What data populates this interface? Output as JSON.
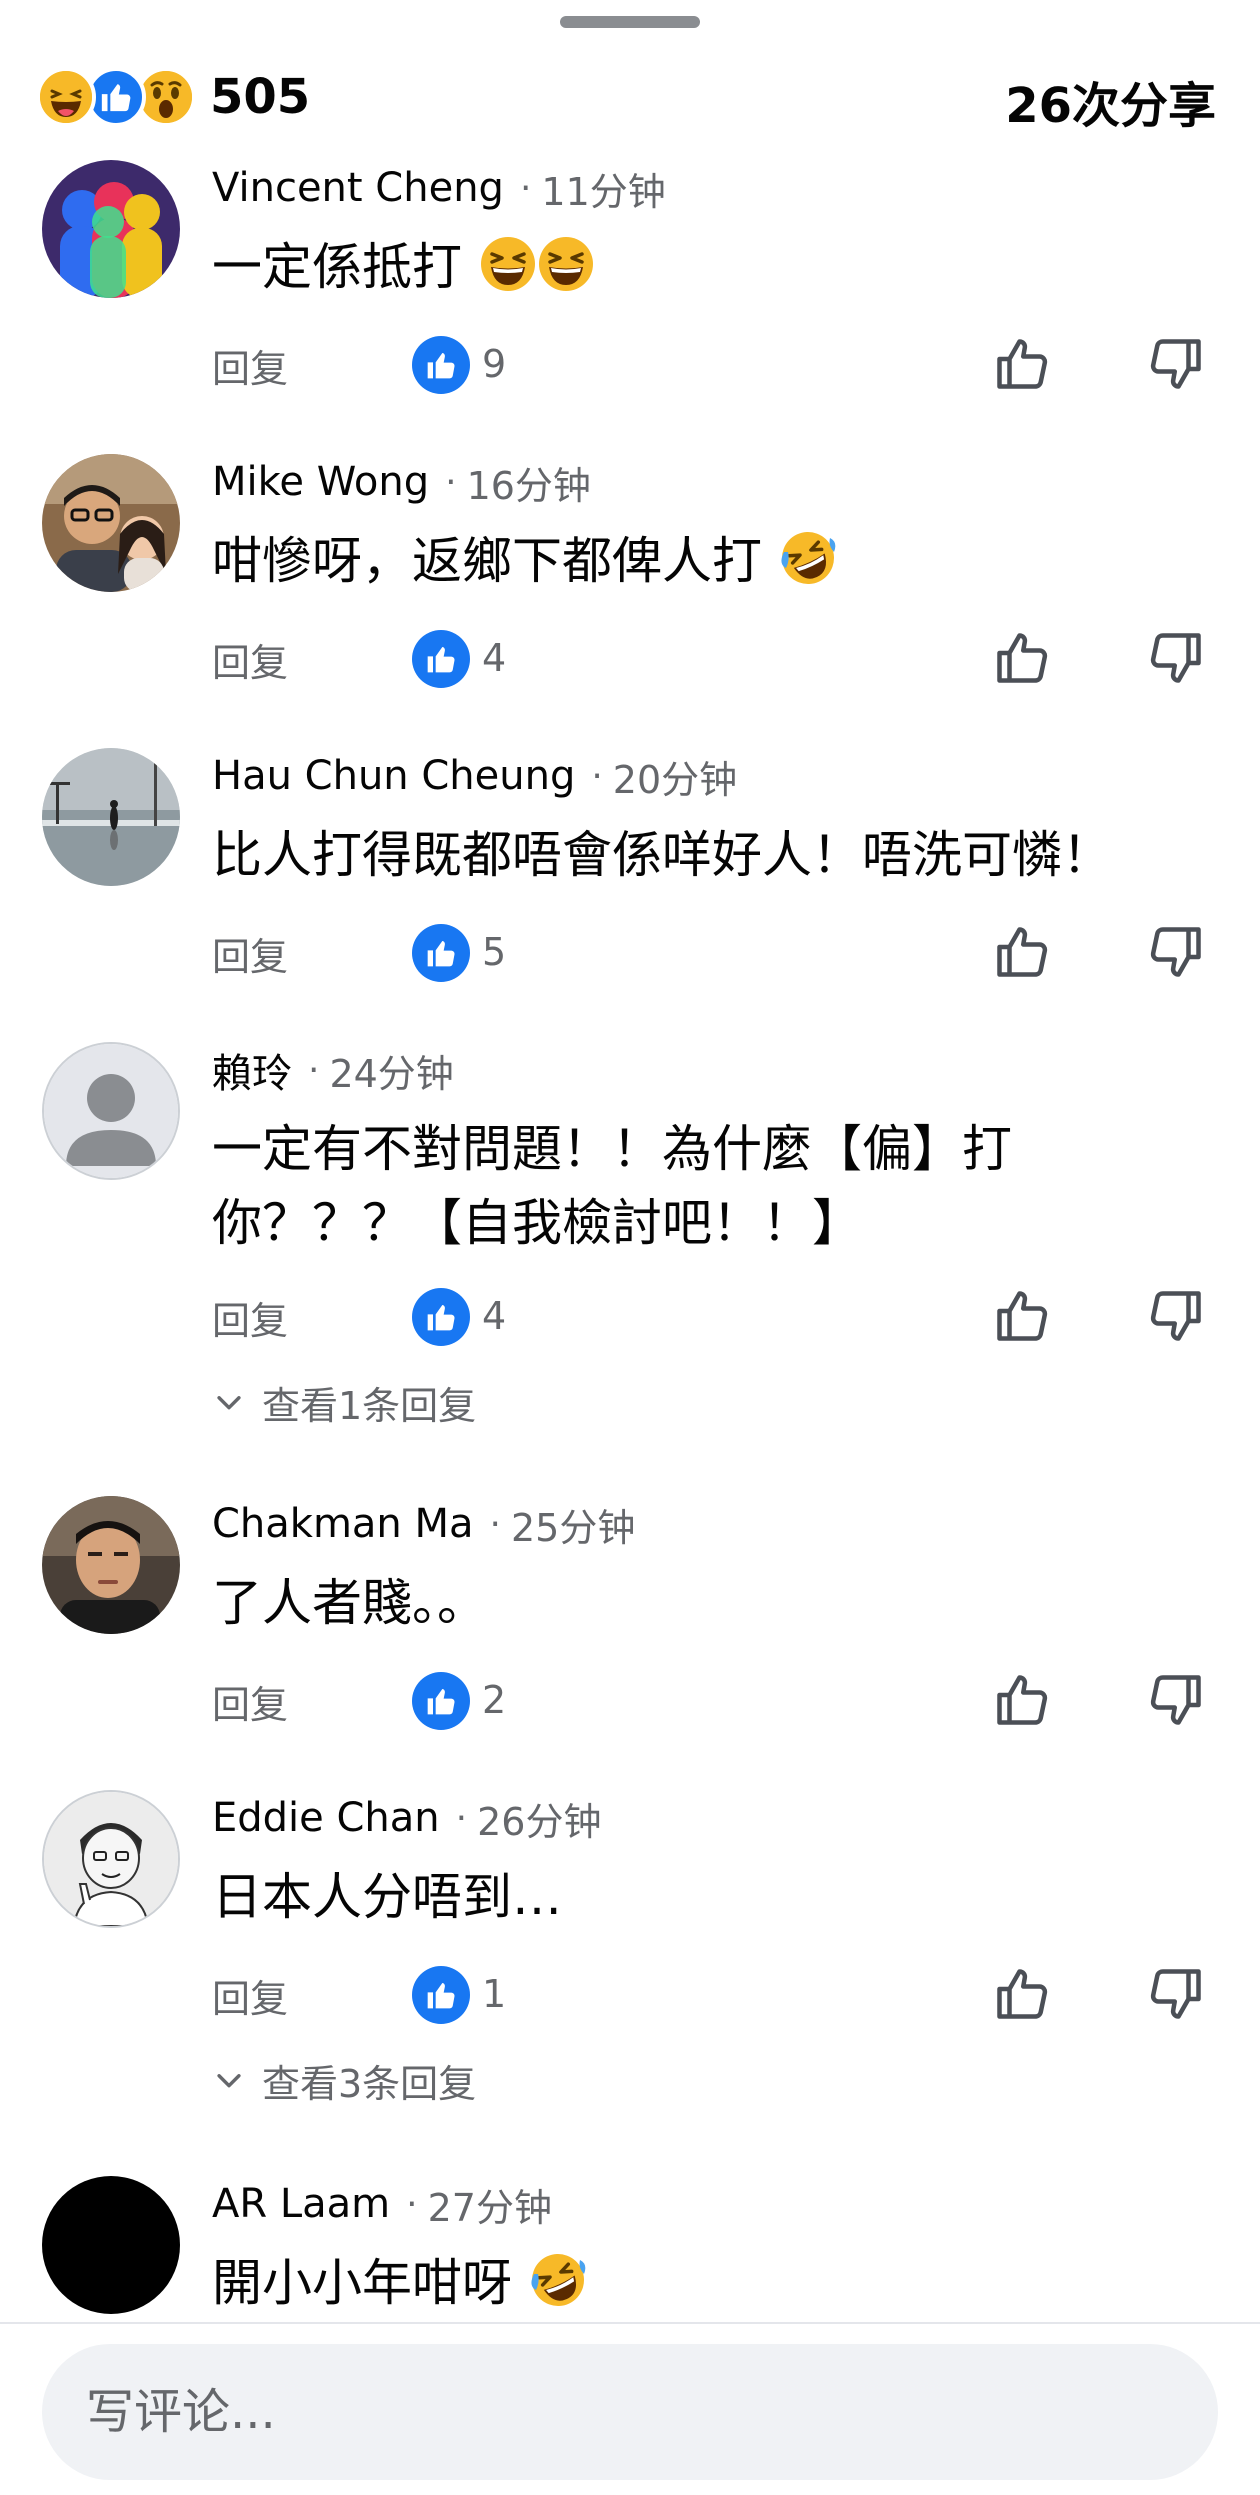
{
  "summary": {
    "reaction_icons": [
      "haha-reaction-icon",
      "like-reaction-icon",
      "wow-reaction-icon"
    ],
    "reaction_count": "505",
    "share_count": "26次分享"
  },
  "labels": {
    "reply": "回复"
  },
  "comments": [
    {
      "author": "Vincent Cheng",
      "time": "11分钟",
      "text": "一定係抵打",
      "emoji": [
        "grinning-squinting-emoji",
        "grinning-squinting-emoji"
      ],
      "likes": "9"
    },
    {
      "author": "Mike Wong",
      "time": "16分钟",
      "text": "咁慘呀，返鄉下都俾人打",
      "emoji": [
        "rolling-laughing-emoji"
      ],
      "likes": "4"
    },
    {
      "author": "Hau Chun Cheung",
      "time": "20分钟",
      "text": "比人打得既都唔會係咩好人！唔洗可憐！",
      "emoji": [],
      "likes": "5"
    },
    {
      "author": "賴玲",
      "time": "24分钟",
      "text_lines": [
        "一定有不對問題！！為什麼【偏】打",
        "你？？？【自我檢討吧！！】"
      ],
      "likes": "4",
      "view_replies": "查看1条回复"
    },
    {
      "author": "Chakman Ma",
      "time": "25分钟",
      "text": "了人者賤。。",
      "emoji": [],
      "likes": "2"
    },
    {
      "author": "Eddie Chan",
      "time": "26分钟",
      "text": "日本人分唔到…",
      "emoji": [],
      "likes": "1",
      "view_replies": "查看3条回复"
    },
    {
      "author": "AR Laam",
      "time": "27分钟",
      "text": "開小小年咁呀",
      "emoji": [
        "rolling-laughing-emoji"
      ]
    }
  ],
  "composer": {
    "placeholder": "写评论..."
  },
  "colors": {
    "accent": "#1877f2",
    "secondary_text": "#65676b",
    "primary_text": "#050505",
    "composer_bg": "#f0f2f5"
  }
}
